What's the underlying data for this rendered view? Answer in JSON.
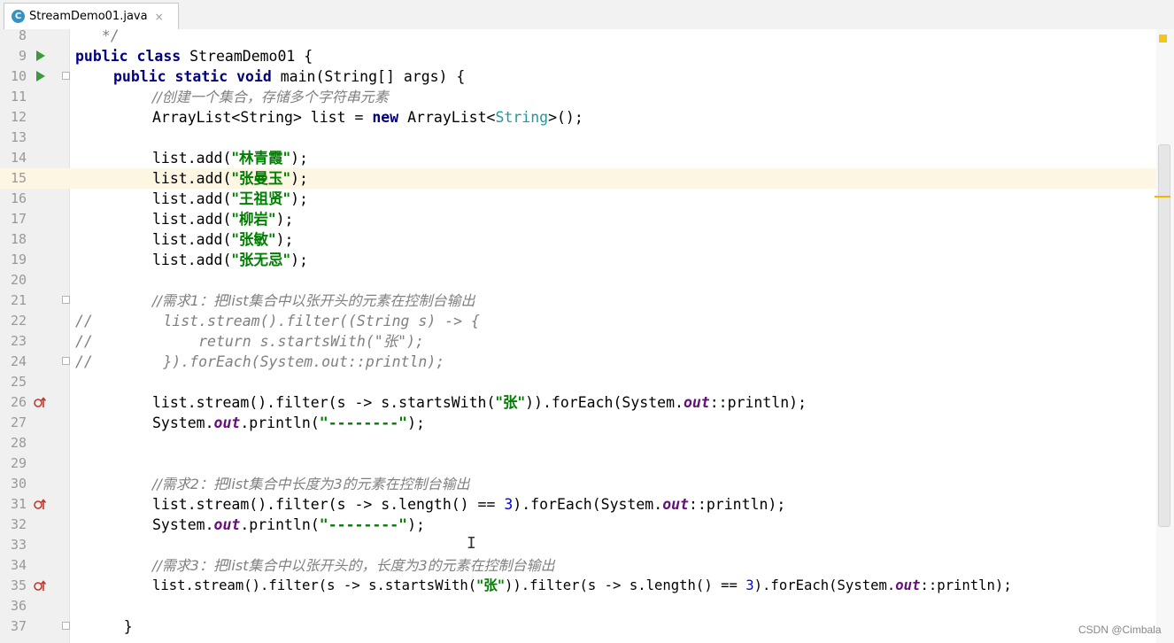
{
  "tab": {
    "filename": "StreamDemo01.java",
    "icon_letter": "C",
    "close_glyph": "×"
  },
  "lines": {
    "l8": {
      "num": "8",
      "t": "   */"
    },
    "l9": {
      "num": "9",
      "a": "public class",
      "b": " StreamDemo01 {"
    },
    "l10": {
      "num": "10",
      "a": "public static void",
      "b": " main(String[] args) {"
    },
    "l11": {
      "num": "11",
      "t": "//创建一个集合，存储多个字符串元素"
    },
    "l12": {
      "num": "12",
      "a": "ArrayList<String> list = ",
      "k": "new",
      "b": " ArrayList<",
      "g": "String",
      "c": ">();"
    },
    "l13": {
      "num": "13"
    },
    "l14": {
      "num": "14",
      "a": "list.add(",
      "s": "\"林青霞\"",
      "b": ");"
    },
    "l15": {
      "num": "15",
      "a": "list.add(",
      "s": "\"张曼玉\"",
      "b": ");"
    },
    "l16": {
      "num": "16",
      "a": "list.add(",
      "s": "\"王祖贤\"",
      "b": ");"
    },
    "l17": {
      "num": "17",
      "a": "list.add(",
      "s": "\"柳岩\"",
      "b": ");"
    },
    "l18": {
      "num": "18",
      "a": "list.add(",
      "s": "\"张敏\"",
      "b": ");"
    },
    "l19": {
      "num": "19",
      "a": "list.add(",
      "s": "\"张无忌\"",
      "b": ");"
    },
    "l20": {
      "num": "20"
    },
    "l21": {
      "num": "21",
      "t": "//需求1：把list集合中以张开头的元素在控制台输出"
    },
    "l22": {
      "num": "22",
      "t": "//        list.stream().filter((String s) -> {"
    },
    "l23": {
      "num": "23",
      "t": "//            return s.startsWith(\"张\");"
    },
    "l24": {
      "num": "24",
      "t": "//        }).forEach(System.out::println);"
    },
    "l25": {
      "num": "25"
    },
    "l26": {
      "num": "26",
      "a": "list.stream().filter(s -> s.startsWith(",
      "s": "\"张\"",
      "b": ")).forEach(System.",
      "f": "out",
      "c": "::println);"
    },
    "l27": {
      "num": "27",
      "a": "System.",
      "f": "out",
      "b": ".println(",
      "s": "\"--------\"",
      "c": ");"
    },
    "l28": {
      "num": "28"
    },
    "l29": {
      "num": "29"
    },
    "l30": {
      "num": "30",
      "t": "//需求2：把list集合中长度为3的元素在控制台输出"
    },
    "l31": {
      "num": "31",
      "a": "list.stream().filter(s -> s.length() == ",
      "n": "3",
      "b": ").forEach(System.",
      "f": "out",
      "c": "::println);"
    },
    "l32": {
      "num": "32",
      "a": "System.",
      "f": "out",
      "b": ".println(",
      "s": "\"--------\"",
      "c": ");"
    },
    "l33": {
      "num": "33"
    },
    "l34": {
      "num": "34",
      "t": "//需求3：把list集合中以张开头的，长度为3的元素在控制台输出"
    },
    "l35": {
      "num": "35",
      "a": "list.stream().filter(s -> s.startsWith(",
      "s": "\"张\"",
      "b": ")).filter(s -> s.length() == ",
      "n": "3",
      "c": ").forEach(System.",
      "f": "out",
      "d": "::println);"
    },
    "l36": {
      "num": "36"
    },
    "l37": {
      "num": "37",
      "t": "    }"
    }
  },
  "cursor_glyph": "I",
  "watermark": "CSDN @Cimbala"
}
